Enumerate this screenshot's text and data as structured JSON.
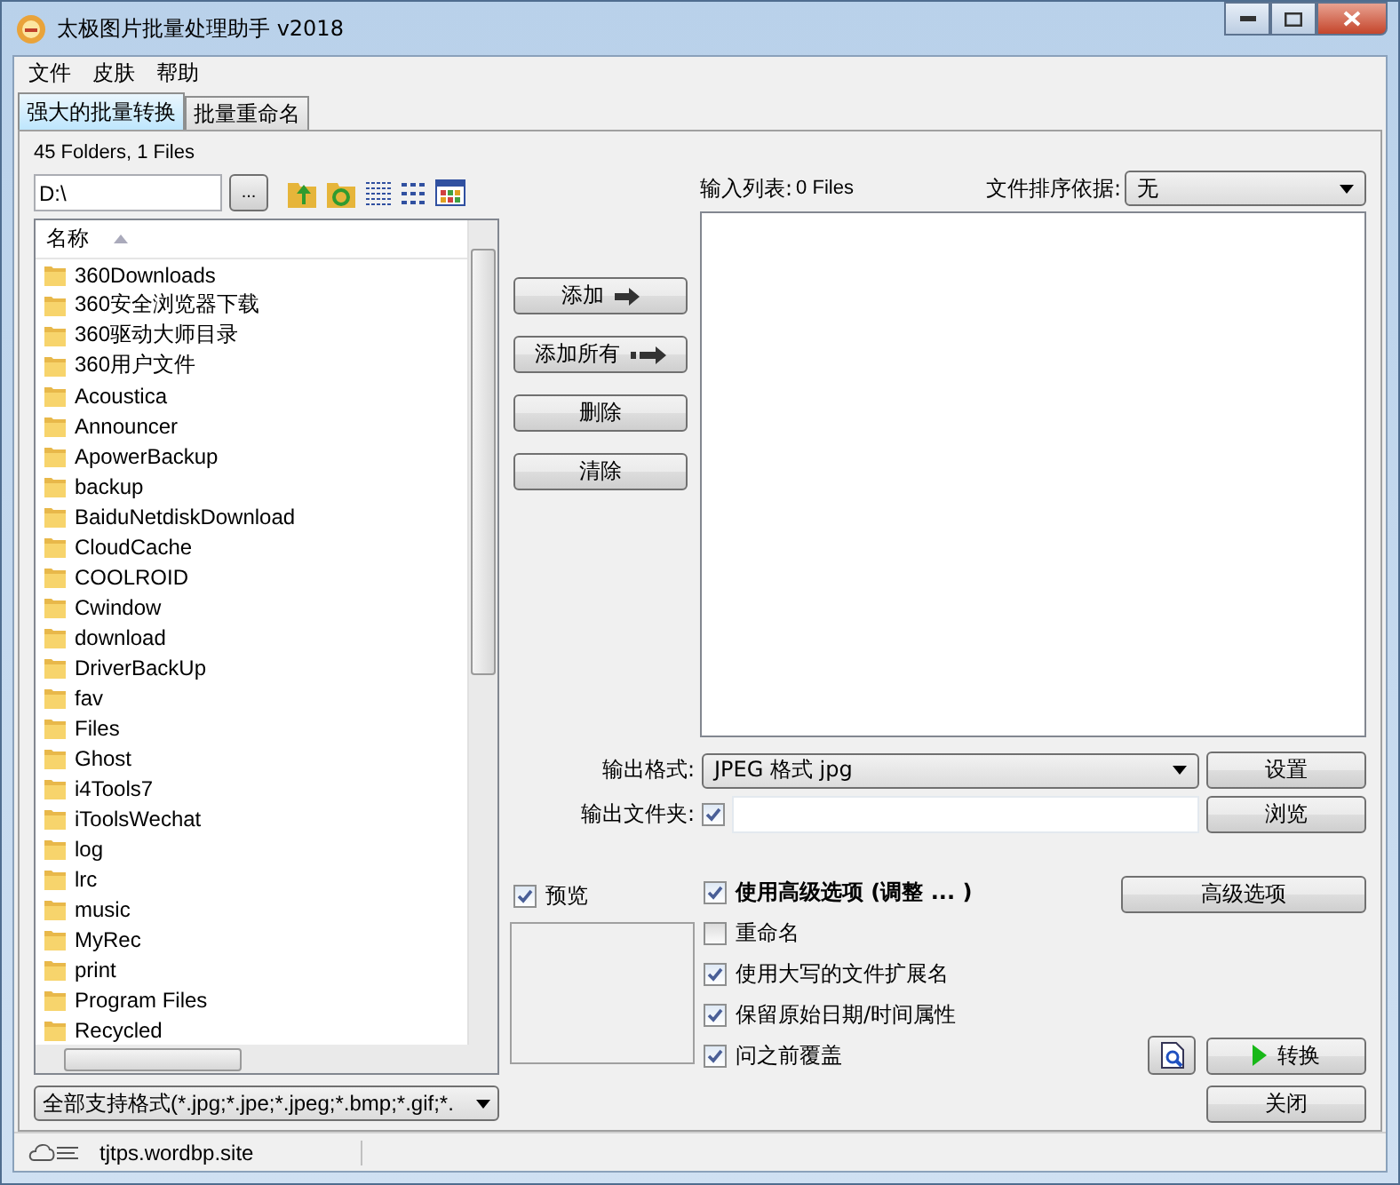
{
  "window": {
    "title": "太极图片批量处理助手  v2018"
  },
  "menu": [
    "文件",
    "皮肤",
    "帮助"
  ],
  "tabs": [
    {
      "label": "强大的批量转换",
      "selected": true
    },
    {
      "label": "批量重命名",
      "selected": false
    }
  ],
  "browser": {
    "summary": "45 Folders, 1 Files",
    "path": "D:\\",
    "browse_button": "...",
    "column": "名称",
    "items": [
      "360Downloads",
      "360安全浏览器下载",
      "360驱动大师目录",
      "360用户文件",
      "Acoustica",
      "Announcer",
      "ApowerBackup",
      "backup",
      "BaiduNetdiskDownload",
      "CloudCache",
      "COOLROID",
      "Cwindow",
      "download",
      "DriverBackUp",
      "fav",
      "Files",
      "Ghost",
      "i4Tools7",
      "iToolsWechat",
      "log",
      "lrc",
      "music",
      "MyRec",
      "print",
      "Program Files",
      "Recycled"
    ],
    "filter": "全部支持格式(*.jpg;*.jpe;*.jpeg;*.bmp;*.gif;*."
  },
  "actions": [
    {
      "label": "添加",
      "kind": "arrow"
    },
    {
      "label": "添加所有",
      "kind": "double-arrow"
    },
    {
      "label": "删除",
      "kind": "plain"
    },
    {
      "label": "清除",
      "kind": "plain"
    }
  ],
  "input_list": {
    "label": "输入列表:",
    "count": "0 Files",
    "sort_label": "文件排序依据:",
    "sort_value": "无"
  },
  "output": {
    "format_label": "输出格式:",
    "format_value": "JPEG 格式 jpg",
    "settings_button": "设置",
    "folder_label": "输出文件夹:",
    "folder_checked": true,
    "browse_button": "浏览"
  },
  "preview": {
    "label": "预览",
    "checked": true
  },
  "options": [
    {
      "label": "使用高级选项 (调整 ... )",
      "checked": true,
      "bold": true
    },
    {
      "label": "重命名",
      "checked": false,
      "bold": false
    },
    {
      "label": "使用大写的文件扩展名",
      "checked": true,
      "bold": false
    },
    {
      "label": "保留原始日期/时间属性",
      "checked": true,
      "bold": false
    },
    {
      "label": "问之前覆盖",
      "checked": true,
      "bold": false
    }
  ],
  "advanced_button": "高级选项",
  "convert_button": "转换",
  "close_button": "关闭",
  "status_bar": {
    "text": "tjtps.wordbp.site"
  }
}
